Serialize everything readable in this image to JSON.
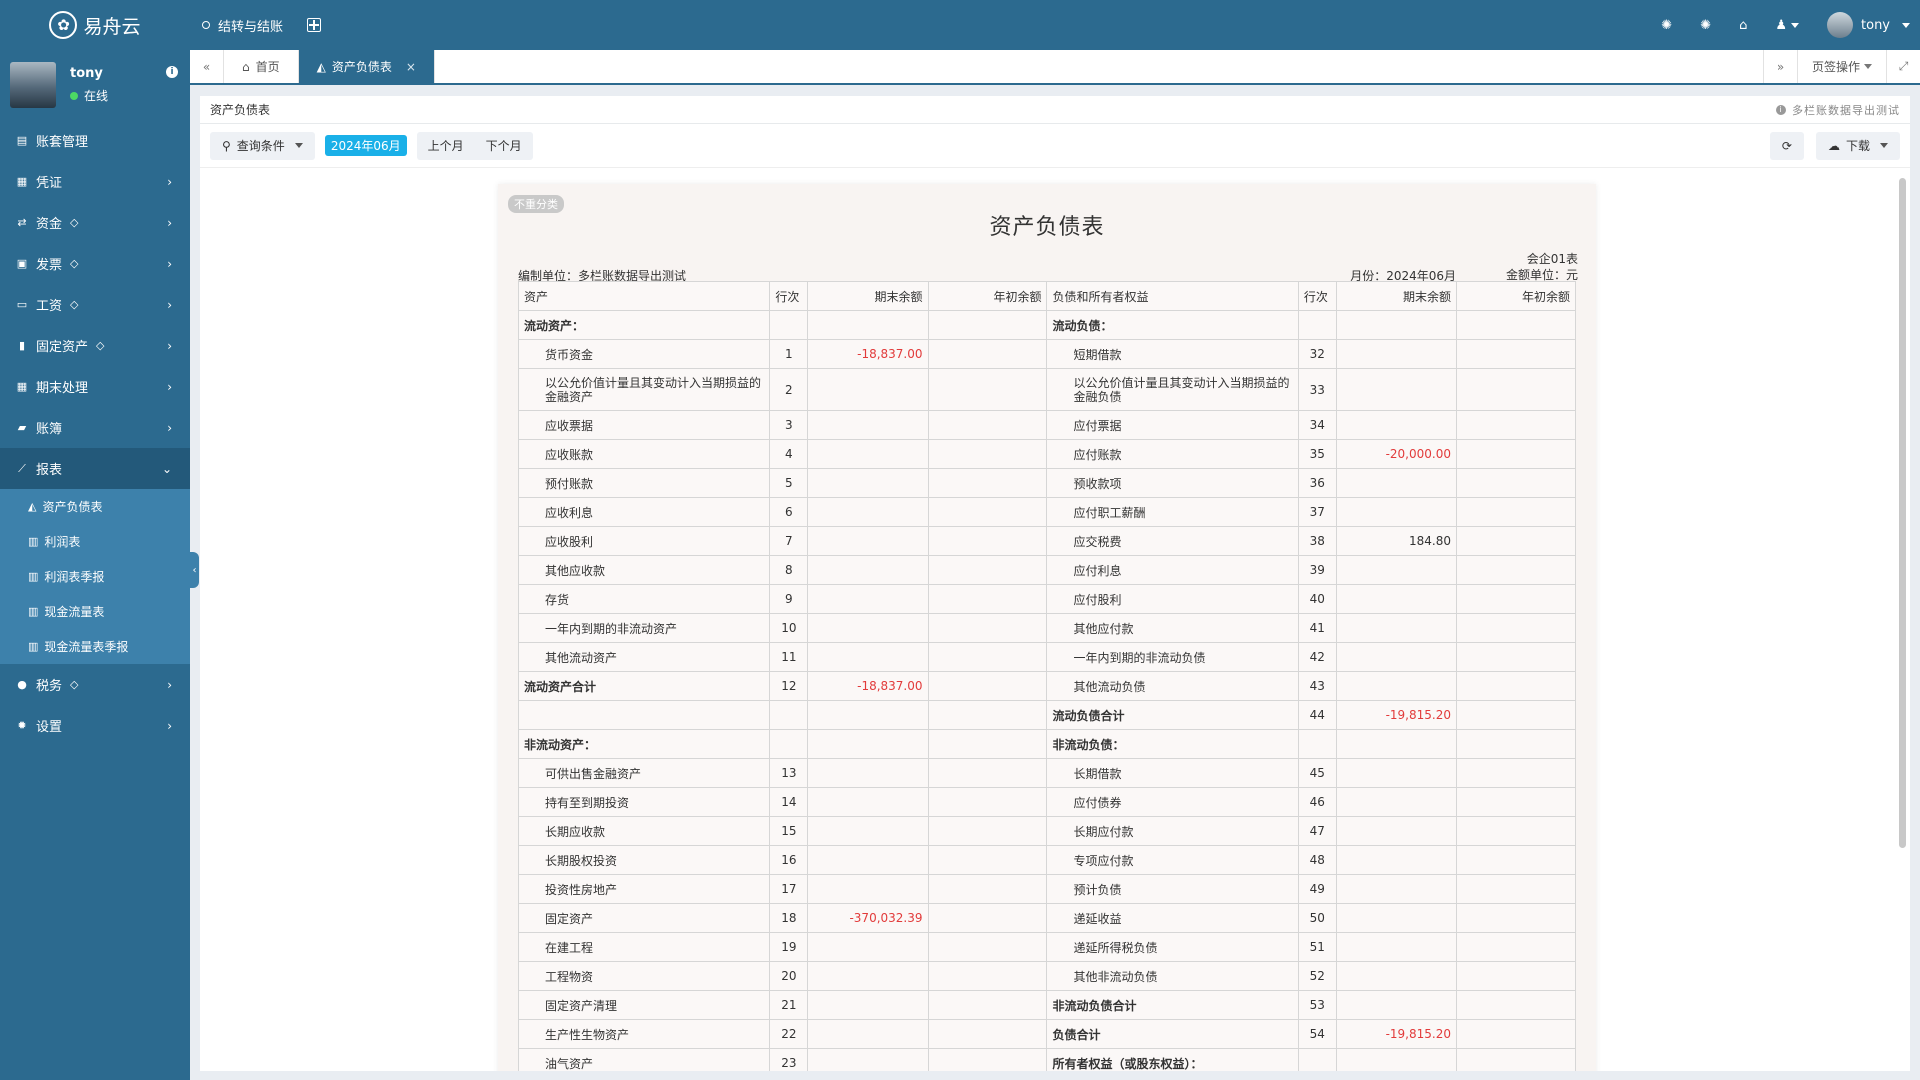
{
  "app": {
    "logo": "易舟云",
    "top_nav": "结转与结账",
    "user": "tony"
  },
  "sidebar": {
    "profile": {
      "name": "tony",
      "status": "在线"
    },
    "items": [
      {
        "label": "账套管理"
      },
      {
        "label": "凭证"
      },
      {
        "label": "资金"
      },
      {
        "label": "发票"
      },
      {
        "label": "工资"
      },
      {
        "label": "固定资产"
      },
      {
        "label": "期末处理"
      },
      {
        "label": "账簿"
      },
      {
        "label": "报表"
      },
      {
        "label": "税务"
      },
      {
        "label": "设置"
      }
    ],
    "report_sub": [
      "资产负债表",
      "利润表",
      "利润表季报",
      "现金流量表",
      "现金流量表季报"
    ]
  },
  "tabs": {
    "home": "首页",
    "active": "资产负债表",
    "page_ops": "页签操作"
  },
  "panel": {
    "title": "资产负债表",
    "hint": "多栏账数据导出测试"
  },
  "toolbar": {
    "query": "查询条件",
    "month": "2024年06月",
    "prev": "上个月",
    "next": "下个月",
    "download": "下载"
  },
  "report": {
    "tag": "不重分类",
    "title": "资产负债表",
    "unit": "编制单位：多栏账数据导出测试",
    "form_no": "会企01表",
    "month": "月份：2024年06月",
    "currency": "金额单位：元",
    "headers": [
      "资产",
      "行次",
      "期末余额",
      "年初余额",
      "负债和所有者权益",
      "行次",
      "期末余额",
      "年初余额"
    ],
    "rows": [
      {
        "a": "流动资产：",
        "an": "",
        "ae": "",
        "ab": "",
        "l": "流动负债：",
        "ln": "",
        "le": "",
        "lb": "",
        "ah": 1,
        "lh": 1
      },
      {
        "a": "货币资金",
        "an": "1",
        "ae": "-18,837.00",
        "ab": "",
        "l": "短期借款",
        "ln": "32",
        "le": "",
        "lb": ""
      },
      {
        "a": "以公允价值计量且其变动计入当期损益的金融资产",
        "an": "2",
        "ae": "",
        "ab": "",
        "l": "以公允价值计量且其变动计入当期损益的金融负债",
        "ln": "33",
        "le": "",
        "lb": "",
        "tall": 1
      },
      {
        "a": "应收票据",
        "an": "3",
        "ae": "",
        "ab": "",
        "l": "应付票据",
        "ln": "34",
        "le": "",
        "lb": ""
      },
      {
        "a": "应收账款",
        "an": "4",
        "ae": "",
        "ab": "",
        "l": "应付账款",
        "ln": "35",
        "le": "-20,000.00",
        "lb": ""
      },
      {
        "a": "预付账款",
        "an": "5",
        "ae": "",
        "ab": "",
        "l": "预收款项",
        "ln": "36",
        "le": "",
        "lb": ""
      },
      {
        "a": "应收利息",
        "an": "6",
        "ae": "",
        "ab": "",
        "l": "应付职工薪酬",
        "ln": "37",
        "le": "",
        "lb": ""
      },
      {
        "a": "应收股利",
        "an": "7",
        "ae": "",
        "ab": "",
        "l": "应交税费",
        "ln": "38",
        "le": "184.80",
        "lb": ""
      },
      {
        "a": "其他应收款",
        "an": "8",
        "ae": "",
        "ab": "",
        "l": "应付利息",
        "ln": "39",
        "le": "",
        "lb": ""
      },
      {
        "a": "存货",
        "an": "9",
        "ae": "",
        "ab": "",
        "l": "应付股利",
        "ln": "40",
        "le": "",
        "lb": ""
      },
      {
        "a": "一年内到期的非流动资产",
        "an": "10",
        "ae": "",
        "ab": "",
        "l": "其他应付款",
        "ln": "41",
        "le": "",
        "lb": ""
      },
      {
        "a": "其他流动资产",
        "an": "11",
        "ae": "",
        "ab": "",
        "l": "一年内到期的非流动负债",
        "ln": "42",
        "le": "",
        "lb": ""
      },
      {
        "a": "流动资产合计",
        "an": "12",
        "ae": "-18,837.00",
        "ab": "",
        "l": "其他流动负债",
        "ln": "43",
        "le": "",
        "lb": "",
        "ah": 1
      },
      {
        "a": "",
        "an": "",
        "ae": "",
        "ab": "",
        "l": "流动负债合计",
        "ln": "44",
        "le": "-19,815.20",
        "lb": "",
        "lh": 1
      },
      {
        "a": "非流动资产：",
        "an": "",
        "ae": "",
        "ab": "",
        "l": "非流动负债：",
        "ln": "",
        "le": "",
        "lb": "",
        "ah": 1,
        "lh": 1
      },
      {
        "a": "可供出售金融资产",
        "an": "13",
        "ae": "",
        "ab": "",
        "l": "长期借款",
        "ln": "45",
        "le": "",
        "lb": ""
      },
      {
        "a": "持有至到期投资",
        "an": "14",
        "ae": "",
        "ab": "",
        "l": "应付债券",
        "ln": "46",
        "le": "",
        "lb": ""
      },
      {
        "a": "长期应收款",
        "an": "15",
        "ae": "",
        "ab": "",
        "l": "长期应付款",
        "ln": "47",
        "le": "",
        "lb": ""
      },
      {
        "a": "长期股权投资",
        "an": "16",
        "ae": "",
        "ab": "",
        "l": "专项应付款",
        "ln": "48",
        "le": "",
        "lb": ""
      },
      {
        "a": "投资性房地产",
        "an": "17",
        "ae": "",
        "ab": "",
        "l": "预计负债",
        "ln": "49",
        "le": "",
        "lb": ""
      },
      {
        "a": "固定资产",
        "an": "18",
        "ae": "-370,032.39",
        "ab": "",
        "l": "递延收益",
        "ln": "50",
        "le": "",
        "lb": ""
      },
      {
        "a": "在建工程",
        "an": "19",
        "ae": "",
        "ab": "",
        "l": "递延所得税负债",
        "ln": "51",
        "le": "",
        "lb": ""
      },
      {
        "a": "工程物资",
        "an": "20",
        "ae": "",
        "ab": "",
        "l": "其他非流动负债",
        "ln": "52",
        "le": "",
        "lb": ""
      },
      {
        "a": "固定资产清理",
        "an": "21",
        "ae": "",
        "ab": "",
        "l": "非流动负债合计",
        "ln": "53",
        "le": "",
        "lb": "",
        "lh": 1
      },
      {
        "a": "生产性生物资产",
        "an": "22",
        "ae": "",
        "ab": "",
        "l": "负债合计",
        "ln": "54",
        "le": "-19,815.20",
        "lb": "",
        "lh": 1
      },
      {
        "a": "油气资产",
        "an": "23",
        "ae": "",
        "ab": "",
        "l": "所有者权益（或股东权益）：",
        "ln": "",
        "le": "",
        "lb": "",
        "lh": 1
      }
    ]
  }
}
